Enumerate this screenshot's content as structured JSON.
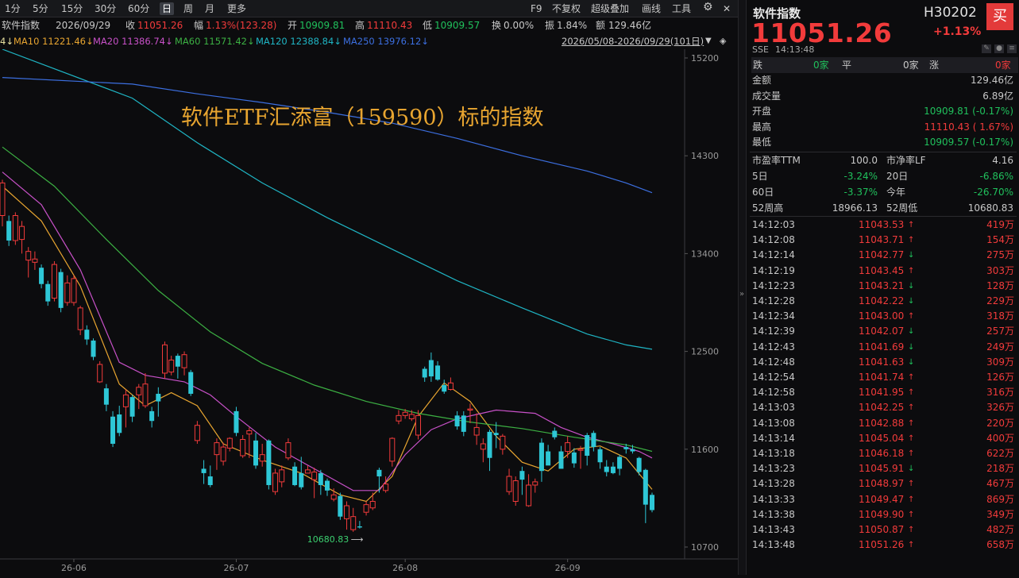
{
  "toolbar": {
    "timeframes": [
      "1分",
      "5分",
      "15分",
      "30分",
      "60分",
      "日",
      "周",
      "月",
      "更多"
    ],
    "active": "日",
    "right_items": [
      "F9",
      "不复权",
      "超级叠加",
      "画线",
      "工具"
    ]
  },
  "info": {
    "name": "软件指数",
    "date": "2026/09/29",
    "close_label": "收",
    "close": "11051.26",
    "range_label": "幅",
    "range": "1.13%(123.28)",
    "open_label": "开",
    "open": "10909.81",
    "high_label": "高",
    "high": "11110.43",
    "low_label": "低",
    "low": "10909.57",
    "turnover_label": "换",
    "turnover": "0.00%",
    "amp_label": "振",
    "amp": "1.84%",
    "amount_label": "额",
    "amount": "129.46亿"
  },
  "ma": {
    "prefix": "4↓",
    "items": [
      {
        "label": "MA10",
        "value": "11221.46↓",
        "color": "#e8a530"
      },
      {
        "label": "MA20",
        "value": "11386.74↓",
        "color": "#c851c8"
      },
      {
        "label": "MA60",
        "value": "11571.42↓",
        "color": "#3cb043"
      },
      {
        "label": "MA120",
        "value": "12388.84↓",
        "color": "#1fb5c4"
      },
      {
        "label": "MA250",
        "value": "13976.12↓",
        "color": "#3c6fe0"
      }
    ],
    "range_text": "2026/05/08-2026/09/29(101日)"
  },
  "chart_data": {
    "type": "candlestick",
    "title": "软件ETF汇添富（159590）标的指数",
    "ylim": [
      10620,
      15300
    ],
    "y_ticks": [
      15200,
      14300,
      13400,
      12500,
      11600,
      10700
    ],
    "x_ticks": [
      {
        "i": 11,
        "label": "26-06"
      },
      {
        "i": 36,
        "label": "26-07"
      },
      {
        "i": 62,
        "label": "26-08"
      },
      {
        "i": 87,
        "label": "26-09"
      }
    ],
    "min_label": "10680.83",
    "candles": [
      [
        13750,
        14050,
        14080,
        13650
      ],
      [
        13700,
        13520,
        13750,
        13470
      ],
      [
        13520,
        13750,
        13780,
        13480
      ],
      [
        13530,
        13650,
        13700,
        13400
      ],
      [
        13340,
        13420,
        13460,
        13180
      ],
      [
        13320,
        13350,
        13420,
        13250
      ],
      [
        13270,
        13120,
        13300,
        13080
      ],
      [
        13120,
        12960,
        13150,
        12920
      ],
      [
        12990,
        13300,
        13330,
        12960
      ],
      [
        13230,
        12900,
        13260,
        12860
      ],
      [
        12950,
        13130,
        13200,
        12920
      ],
      [
        12950,
        13170,
        13200,
        12920
      ],
      [
        12700,
        12900,
        12920,
        12650
      ],
      [
        12700,
        12610,
        12740,
        12560
      ],
      [
        12600,
        12450,
        12620,
        12420
      ],
      [
        12220,
        12380,
        12410,
        12210
      ],
      [
        12160,
        12010,
        12200,
        11950
      ],
      [
        11900,
        11650,
        11950,
        11620
      ],
      [
        11920,
        11750,
        12000,
        11720
      ],
      [
        11990,
        12100,
        12150,
        11800
      ],
      [
        12080,
        11900,
        12100,
        11850
      ],
      [
        12100,
        12170,
        12200,
        11970
      ],
      [
        12000,
        12200,
        12300,
        11980
      ],
      [
        11950,
        11860,
        11990,
        11800
      ],
      [
        12110,
        12040,
        12170,
        11900
      ],
      [
        12300,
        12560,
        12590,
        12250
      ],
      [
        12310,
        12420,
        12460,
        12280
      ],
      [
        12460,
        12360,
        12480,
        12250
      ],
      [
        12350,
        12470,
        12500,
        12280
      ],
      [
        12310,
        12110,
        12330,
        12090
      ],
      [
        11680,
        11820,
        11860,
        11650
      ],
      [
        11420,
        11380,
        11500,
        11280
      ],
      [
        11350,
        11270,
        11450,
        11250
      ],
      [
        11550,
        11660,
        11700,
        11410
      ],
      [
        11490,
        11620,
        11660,
        11450
      ],
      [
        11610,
        11700,
        11710,
        11580
      ],
      [
        11950,
        11750,
        11990,
        11720
      ],
      [
        11540,
        11690,
        11730,
        11520
      ],
      [
        11740,
        11770,
        11800,
        11520
      ],
      [
        11680,
        11450,
        11750,
        11420
      ],
      [
        11490,
        11550,
        11650,
        11440
      ],
      [
        11680,
        11270,
        11690,
        11230
      ],
      [
        11210,
        11380,
        11420,
        11180
      ],
      [
        11300,
        11410,
        11450,
        11250
      ],
      [
        11520,
        11660,
        11700,
        11500
      ],
      [
        11440,
        11270,
        11480,
        11260
      ],
      [
        11380,
        11250,
        11530,
        11230
      ],
      [
        11380,
        11410,
        11450,
        11380
      ],
      [
        11320,
        11390,
        11430,
        11150
      ],
      [
        11380,
        11270,
        11410,
        11180
      ],
      [
        11310,
        11220,
        11330,
        11170
      ],
      [
        11140,
        11180,
        11240,
        11120
      ],
      [
        11170,
        10980,
        11200,
        10950
      ],
      [
        10960,
        11080,
        11120,
        10860
      ],
      [
        10860,
        10980,
        11060,
        10840
      ],
      [
        10890,
        10880,
        10940,
        10870
      ],
      [
        11020,
        11090,
        11120,
        10990
      ],
      [
        11060,
        11120,
        11200,
        11040
      ],
      [
        11410,
        11350,
        11430,
        11200
      ],
      [
        11220,
        11280,
        11350,
        11200
      ],
      [
        11490,
        11700,
        11710,
        11440
      ],
      [
        11860,
        11910,
        11960,
        11830
      ],
      [
        11910,
        11940,
        11970,
        11880
      ],
      [
        11880,
        11920,
        11960,
        11860
      ],
      [
        11730,
        11910,
        11960,
        11690
      ],
      [
        12340,
        12260,
        12360,
        12220
      ],
      [
        12420,
        12270,
        12490,
        12220
      ],
      [
        12370,
        12240,
        12410,
        12230
      ],
      [
        12190,
        12130,
        12240,
        12110
      ],
      [
        12150,
        12210,
        12260,
        12140
      ],
      [
        11910,
        11810,
        11950,
        11780
      ],
      [
        11910,
        11760,
        11950,
        11720
      ],
      [
        11960,
        11970,
        12020,
        11840
      ],
      [
        11730,
        11800,
        11930,
        11640
      ],
      [
        11600,
        11650,
        11700,
        11480
      ],
      [
        11760,
        11520,
        11780,
        11400
      ],
      [
        11750,
        11730,
        11850,
        11610
      ],
      [
        11600,
        11720,
        11740,
        11550
      ],
      [
        11210,
        11350,
        11420,
        11180
      ],
      [
        11120,
        11310,
        11350,
        11080
      ],
      [
        11400,
        11320,
        11440,
        11180
      ],
      [
        11080,
        11270,
        11370,
        11070
      ],
      [
        11270,
        11300,
        11330,
        11200
      ],
      [
        11660,
        11400,
        11700,
        11300
      ],
      [
        11580,
        11450,
        11640,
        11550
      ],
      [
        11770,
        11710,
        11800,
        11690
      ],
      [
        11580,
        11420,
        11630,
        11520
      ],
      [
        11580,
        11660,
        11720,
        11520
      ],
      [
        11570,
        11470,
        11610,
        11430
      ],
      [
        11590,
        11600,
        11630,
        11420
      ],
      [
        11730,
        11540,
        11750,
        11450
      ],
      [
        11750,
        11620,
        11770,
        11580
      ],
      [
        11600,
        11480,
        11620,
        11420
      ],
      [
        11440,
        11390,
        11500,
        11350
      ],
      [
        11440,
        11380,
        11480,
        11370
      ],
      [
        11530,
        11420,
        11550,
        11360
      ],
      [
        11620,
        11600,
        11650,
        11560
      ],
      [
        11600,
        11580,
        11640,
        11560
      ],
      [
        11520,
        11390,
        11530,
        11360
      ],
      [
        11410,
        11090,
        11420,
        10920
      ],
      [
        11180,
        11040,
        11200,
        11020
      ]
    ],
    "ma_lines": [
      {
        "name": "MA10",
        "color": "#e8a530",
        "pts": [
          [
            0,
            14020
          ],
          [
            6,
            13700
          ],
          [
            12,
            13100
          ],
          [
            18,
            12200
          ],
          [
            22,
            12000
          ],
          [
            26,
            12120
          ],
          [
            30,
            12000
          ],
          [
            34,
            11650
          ],
          [
            40,
            11500
          ],
          [
            46,
            11380
          ],
          [
            52,
            11180
          ],
          [
            56,
            11120
          ],
          [
            60,
            11350
          ],
          [
            64,
            11900
          ],
          [
            68,
            12210
          ],
          [
            72,
            12040
          ],
          [
            76,
            11720
          ],
          [
            80,
            11480
          ],
          [
            84,
            11400
          ],
          [
            88,
            11600
          ],
          [
            92,
            11630
          ],
          [
            96,
            11520
          ],
          [
            100,
            11230
          ]
        ]
      },
      {
        "name": "MA20",
        "color": "#c851c8",
        "pts": [
          [
            0,
            14150
          ],
          [
            6,
            13850
          ],
          [
            12,
            13250
          ],
          [
            18,
            12400
          ],
          [
            22,
            12280
          ],
          [
            28,
            12220
          ],
          [
            32,
            12100
          ],
          [
            36,
            11900
          ],
          [
            42,
            11620
          ],
          [
            48,
            11420
          ],
          [
            54,
            11220
          ],
          [
            58,
            11220
          ],
          [
            62,
            11550
          ],
          [
            66,
            11780
          ],
          [
            70,
            11880
          ],
          [
            76,
            11960
          ],
          [
            82,
            11930
          ],
          [
            86,
            11800
          ],
          [
            90,
            11710
          ],
          [
            94,
            11650
          ],
          [
            98,
            11580
          ],
          [
            100,
            11520
          ]
        ]
      },
      {
        "name": "MA60",
        "color": "#3cb043",
        "pts": [
          [
            0,
            14380
          ],
          [
            8,
            14020
          ],
          [
            16,
            13530
          ],
          [
            24,
            13060
          ],
          [
            32,
            12680
          ],
          [
            40,
            12390
          ],
          [
            48,
            12190
          ],
          [
            56,
            12040
          ],
          [
            64,
            11930
          ],
          [
            72,
            11850
          ],
          [
            80,
            11790
          ],
          [
            88,
            11710
          ],
          [
            96,
            11640
          ],
          [
            100,
            11580
          ]
        ]
      },
      {
        "name": "MA120",
        "color": "#1fb5c4",
        "pts": [
          [
            0,
            15280
          ],
          [
            20,
            14830
          ],
          [
            30,
            14420
          ],
          [
            40,
            14050
          ],
          [
            50,
            13730
          ],
          [
            60,
            13440
          ],
          [
            70,
            13150
          ],
          [
            80,
            12900
          ],
          [
            90,
            12660
          ],
          [
            96,
            12560
          ],
          [
            100,
            12520
          ]
        ]
      },
      {
        "name": "MA250",
        "color": "#3c6fe0",
        "pts": [
          [
            0,
            15020
          ],
          [
            20,
            14960
          ],
          [
            30,
            14870
          ],
          [
            40,
            14790
          ],
          [
            50,
            14700
          ],
          [
            60,
            14600
          ],
          [
            70,
            14460
          ],
          [
            80,
            14300
          ],
          [
            90,
            14160
          ],
          [
            96,
            14050
          ],
          [
            100,
            13960
          ]
        ]
      }
    ]
  },
  "panel": {
    "name": "软件指数",
    "code": "H30202",
    "buy_label": "买",
    "price": "11051.26",
    "change_pct": "+1.13%",
    "exchange": "SSE",
    "time": "14:13:48",
    "dn_label": "跌",
    "dn_count": "0家",
    "flat_label": "平",
    "flat_count": "0家",
    "up_label": "涨",
    "up_count": "0家",
    "stats": [
      {
        "label": "金额",
        "value": "129.46亿",
        "cls": ""
      },
      {
        "label": "成交量",
        "value": "6.89亿",
        "cls": ""
      },
      {
        "label": "开盘",
        "value": "10909.81 (-0.17%)",
        "cls": "dn"
      },
      {
        "label": "最高",
        "value": "11110.43 ( 1.67%)",
        "cls": "up"
      },
      {
        "label": "最低",
        "value": "10909.57 (-0.17%)",
        "cls": "dn"
      }
    ],
    "grid": [
      {
        "l1": "市盈率TTM",
        "v1": "100.0",
        "c1": "",
        "l2": "市净率LF",
        "v2": "4.16",
        "c2": ""
      },
      {
        "l1": "5日",
        "v1": "-3.24%",
        "c1": "dn",
        "l2": "20日",
        "v2": "-6.86%",
        "c2": "dn"
      },
      {
        "l1": "60日",
        "v1": "-3.37%",
        "c1": "dn",
        "l2": "今年",
        "v2": "-26.70%",
        "c2": "dn"
      },
      {
        "l1": "52周高",
        "v1": "18966.13",
        "c1": "",
        "l2": "52周低",
        "v2": "10680.83",
        "c2": ""
      }
    ],
    "ticks": [
      {
        "t": "14:12:03",
        "p": "11043.53",
        "d": "up",
        "v": "419万"
      },
      {
        "t": "14:12:08",
        "p": "11043.71",
        "d": "up",
        "v": "154万"
      },
      {
        "t": "14:12:14",
        "p": "11042.77",
        "d": "dn",
        "v": "275万"
      },
      {
        "t": "14:12:19",
        "p": "11043.45",
        "d": "up",
        "v": "303万"
      },
      {
        "t": "14:12:23",
        "p": "11043.21",
        "d": "dn",
        "v": "128万"
      },
      {
        "t": "14:12:28",
        "p": "11042.22",
        "d": "dn",
        "v": "229万"
      },
      {
        "t": "14:12:34",
        "p": "11043.00",
        "d": "up",
        "v": "318万"
      },
      {
        "t": "14:12:39",
        "p": "11042.07",
        "d": "dn",
        "v": "257万"
      },
      {
        "t": "14:12:43",
        "p": "11041.69",
        "d": "dn",
        "v": "249万"
      },
      {
        "t": "14:12:48",
        "p": "11041.63",
        "d": "dn",
        "v": "309万"
      },
      {
        "t": "14:12:54",
        "p": "11041.74",
        "d": "up",
        "v": "126万"
      },
      {
        "t": "14:12:58",
        "p": "11041.95",
        "d": "up",
        "v": "316万"
      },
      {
        "t": "14:13:03",
        "p": "11042.25",
        "d": "up",
        "v": "326万"
      },
      {
        "t": "14:13:08",
        "p": "11042.88",
        "d": "up",
        "v": "220万"
      },
      {
        "t": "14:13:14",
        "p": "11045.04",
        "d": "up",
        "v": "400万"
      },
      {
        "t": "14:13:18",
        "p": "11046.18",
        "d": "up",
        "v": "622万"
      },
      {
        "t": "14:13:23",
        "p": "11045.91",
        "d": "dn",
        "v": "218万"
      },
      {
        "t": "14:13:28",
        "p": "11048.97",
        "d": "up",
        "v": "467万"
      },
      {
        "t": "14:13:33",
        "p": "11049.47",
        "d": "up",
        "v": "869万"
      },
      {
        "t": "14:13:38",
        "p": "11049.90",
        "d": "up",
        "v": "349万"
      },
      {
        "t": "14:13:43",
        "p": "11050.87",
        "d": "up",
        "v": "482万"
      },
      {
        "t": "14:13:48",
        "p": "11051.26",
        "d": "up",
        "v": "658万"
      }
    ]
  },
  "colors": {
    "up": "#f23b3b",
    "down": "#2ec7d6",
    "grid": "#26262a",
    "title": "#e8a530"
  },
  "icons": {
    "settings": "gear-icon",
    "up": "arrow-up-icon",
    "down": "arrow-down-icon"
  }
}
